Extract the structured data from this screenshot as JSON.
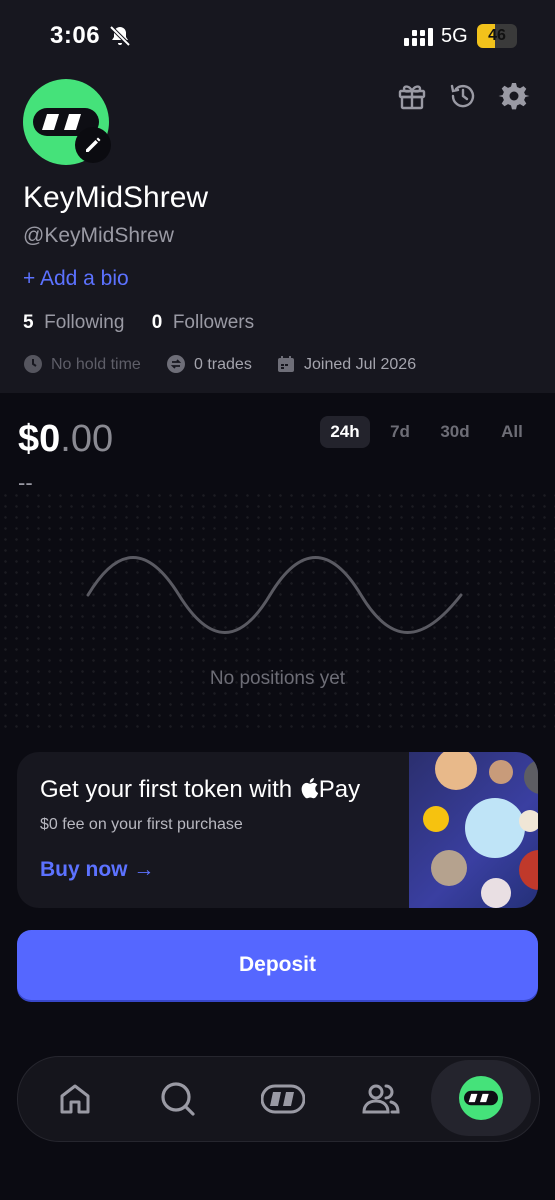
{
  "status_bar": {
    "time": "3:06",
    "network": "5G",
    "battery_level": "46"
  },
  "header_icons": [
    "gift-icon",
    "history-icon",
    "gear-icon"
  ],
  "profile": {
    "display_name": "KeyMidShrew",
    "handle": "@KeyMidShrew",
    "add_bio": "+ Add a bio",
    "following_count": "5",
    "following_label": "Following",
    "followers_count": "0",
    "followers_label": "Followers",
    "hold_time": "No hold time",
    "trades": "0 trades",
    "joined": "Joined Jul 2026"
  },
  "portfolio": {
    "balance_whole": "$0",
    "balance_cents": ".00",
    "change": "--",
    "tabs": [
      "24h",
      "7d",
      "30d",
      "All"
    ],
    "active_tab": "24h",
    "empty_message": "No positions yet"
  },
  "promo": {
    "title": "Get your first token with ",
    "pay_label": "Pay",
    "subtitle": "$0 fee on your first purchase",
    "cta": "Buy now →"
  },
  "deposit_label": "Deposit",
  "nav": {
    "items": [
      "home-icon",
      "search-icon",
      "tokens-icon",
      "community-icon",
      "profile-icon"
    ],
    "active": "profile-icon"
  },
  "colors": {
    "accent": "#5567ff",
    "avatar_green": "#45e27a",
    "battery": "#f2c21b"
  }
}
